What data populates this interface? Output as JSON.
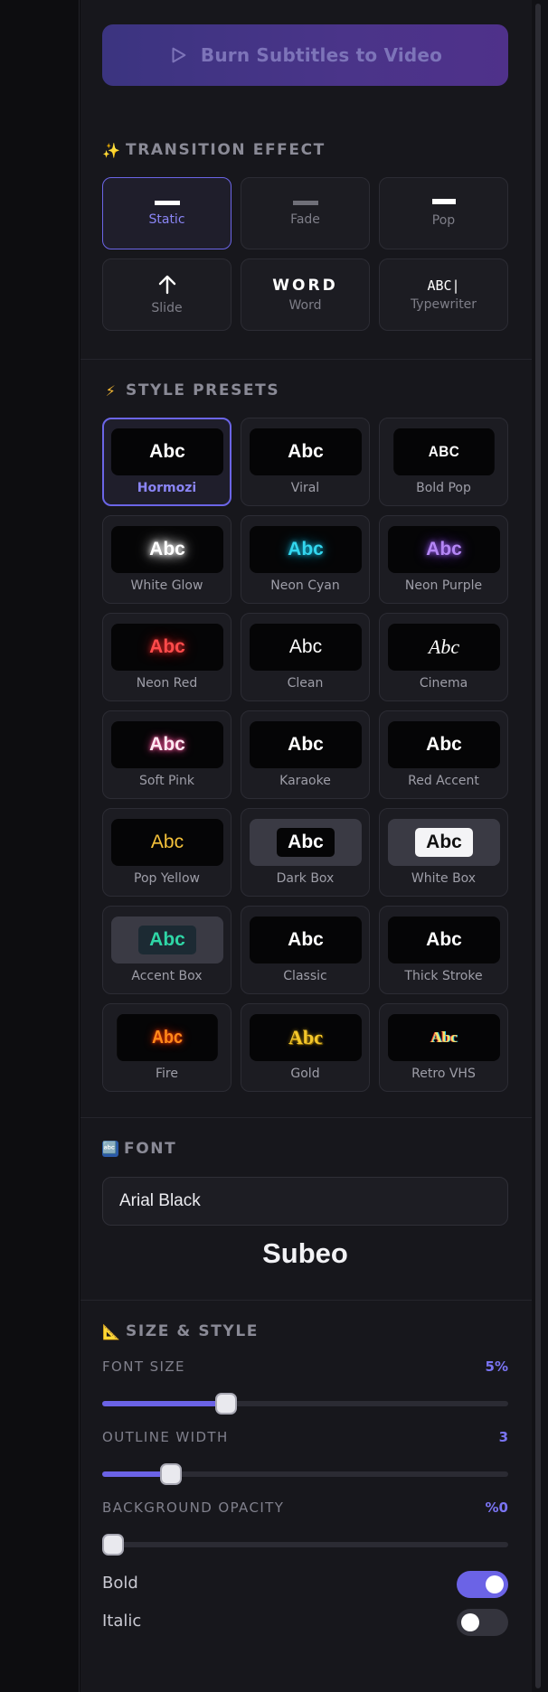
{
  "burn_button": {
    "label": "Burn Subtitles to Video",
    "icon": "play-icon"
  },
  "transition": {
    "title": "TRANSITION EFFECT",
    "emoji": "✨",
    "options": [
      {
        "label": "Static",
        "icon": "dash-icon",
        "active": true
      },
      {
        "label": "Fade",
        "icon": "dash-faded-icon",
        "active": false
      },
      {
        "label": "Pop",
        "icon": "dash-icon",
        "active": false
      },
      {
        "label": "Slide",
        "icon": "arrow-up-icon",
        "active": false
      },
      {
        "label": "Word",
        "glyph": "WORD",
        "active": false
      },
      {
        "label": "Typewriter",
        "glyph": "ABC|",
        "active": false
      }
    ]
  },
  "presets": {
    "title": "STYLE PRESETS",
    "emoji": "⚡",
    "sample": "Abc",
    "items": [
      {
        "name": "Hormozi",
        "active": true
      },
      {
        "name": "Viral"
      },
      {
        "name": "Bold Pop",
        "sample": "ABC"
      },
      {
        "name": "White Glow"
      },
      {
        "name": "Neon Cyan"
      },
      {
        "name": "Neon Purple"
      },
      {
        "name": "Neon Red"
      },
      {
        "name": "Clean"
      },
      {
        "name": "Cinema"
      },
      {
        "name": "Soft Pink"
      },
      {
        "name": "Karaoke"
      },
      {
        "name": "Red Accent"
      },
      {
        "name": "Pop Yellow"
      },
      {
        "name": "Dark Box"
      },
      {
        "name": "White Box"
      },
      {
        "name": "Accent Box"
      },
      {
        "name": "Classic"
      },
      {
        "name": "Thick Stroke"
      },
      {
        "name": "Fire"
      },
      {
        "name": "Gold"
      },
      {
        "name": "Retro VHS"
      }
    ]
  },
  "font": {
    "title": "FONT",
    "emoji": "🔤",
    "selected": "Arial Black",
    "preview": "Subeo"
  },
  "size_style": {
    "title": "SIZE & STYLE",
    "emoji": "📐",
    "font_size": {
      "label": "FONT SIZE",
      "value_text": "5%",
      "fraction": 0.305
    },
    "outline_width": {
      "label": "OUTLINE WIDTH",
      "value_text": "3",
      "fraction": 0.17
    },
    "bg_opacity": {
      "label": "BACKGROUND OPACITY",
      "value_text": "%0",
      "fraction": 0.0
    },
    "bold": {
      "label": "Bold",
      "on": true
    },
    "italic": {
      "label": "Italic",
      "on": false
    }
  },
  "colors": {
    "accent": "#6b63e6",
    "panel": "#17171c"
  }
}
